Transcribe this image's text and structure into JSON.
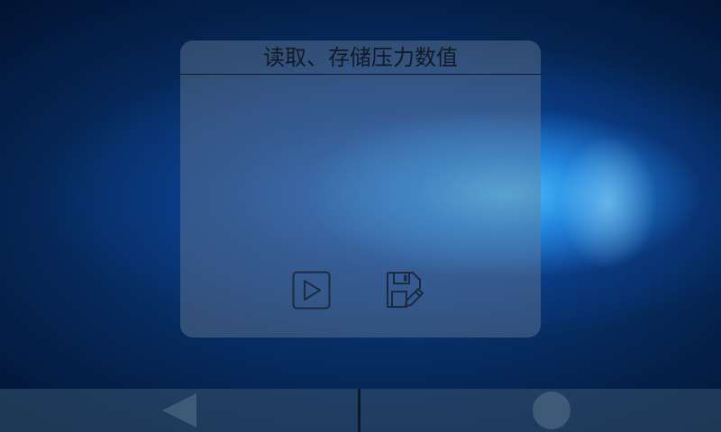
{
  "dialog": {
    "title": "读取、存储压力数值",
    "buttons": [
      {
        "name": "play",
        "icon": "play-icon"
      },
      {
        "name": "save",
        "icon": "floppy-disk-edit-icon"
      }
    ]
  },
  "navbar": {
    "back_icon": "triangle-back-icon",
    "home_icon": "circle-home-icon"
  },
  "colors": {
    "icon_stroke": "#1a2a40",
    "title_text": "#111a26",
    "nav_button": "#3e5a78"
  }
}
